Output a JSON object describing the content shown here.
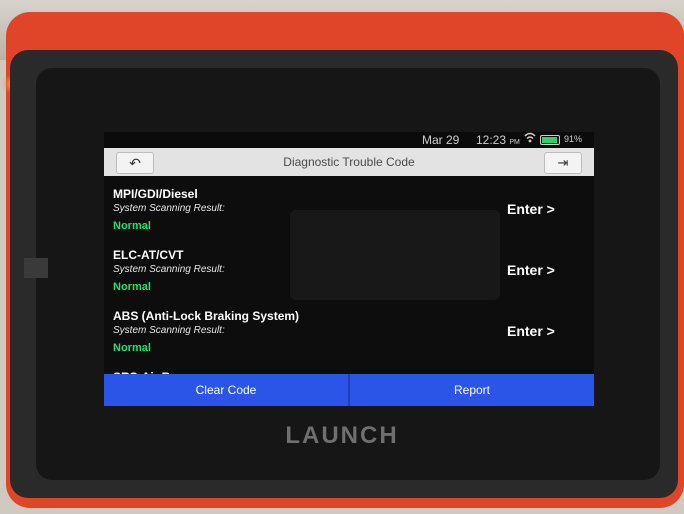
{
  "status_bar": {
    "date": "Mar 29",
    "time": "12:23",
    "ampm": "PM",
    "battery": "91%",
    "wifi_icon": "wifi-icon",
    "battery_icon": "battery-icon"
  },
  "header": {
    "title": "Diagnostic Trouble Code",
    "back_icon": "back-arrow-icon",
    "exit_icon": "exit-icon"
  },
  "items": [
    {
      "name": "MPI/GDI/Diesel",
      "label": "System Scanning Result:",
      "status": "Normal",
      "action": "Enter >"
    },
    {
      "name": "ELC-AT/CVT",
      "label": "System Scanning Result:",
      "status": "Normal",
      "action": "Enter >"
    },
    {
      "name": "ABS (Anti-Lock Braking System)",
      "label": "System Scanning Result:",
      "status": "Normal",
      "action": "Enter >"
    }
  ],
  "partial_item": "SRS-Air Bag",
  "footer": {
    "clear_label": "Clear Code",
    "report_label": "Report"
  },
  "device": {
    "logo": "LAUNCH"
  },
  "colors": {
    "accent": "#2b55e6",
    "status_ok": "#25e06a",
    "device_body": "#e0452a"
  }
}
